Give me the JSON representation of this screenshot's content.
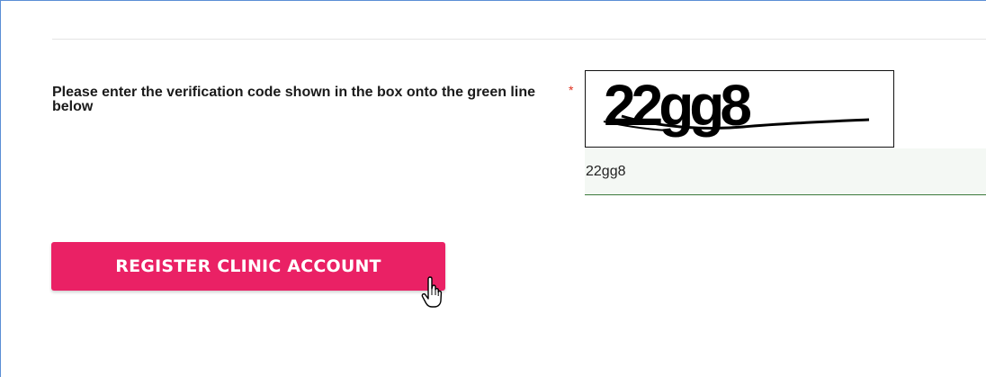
{
  "form": {
    "prompt": "Please enter the verification code shown in the box onto the green line below",
    "required_marker": "*",
    "captcha_text": "22gg8",
    "code_value": "22gg8",
    "submit_label": "REGISTER CLINIC ACCOUNT"
  },
  "colors": {
    "accent": "#ea2165",
    "required": "#e0311f",
    "input_line": "#3c7a3c",
    "frame_border": "#5b8fd6"
  },
  "icons": {
    "cursor": "hand-pointer-icon"
  }
}
